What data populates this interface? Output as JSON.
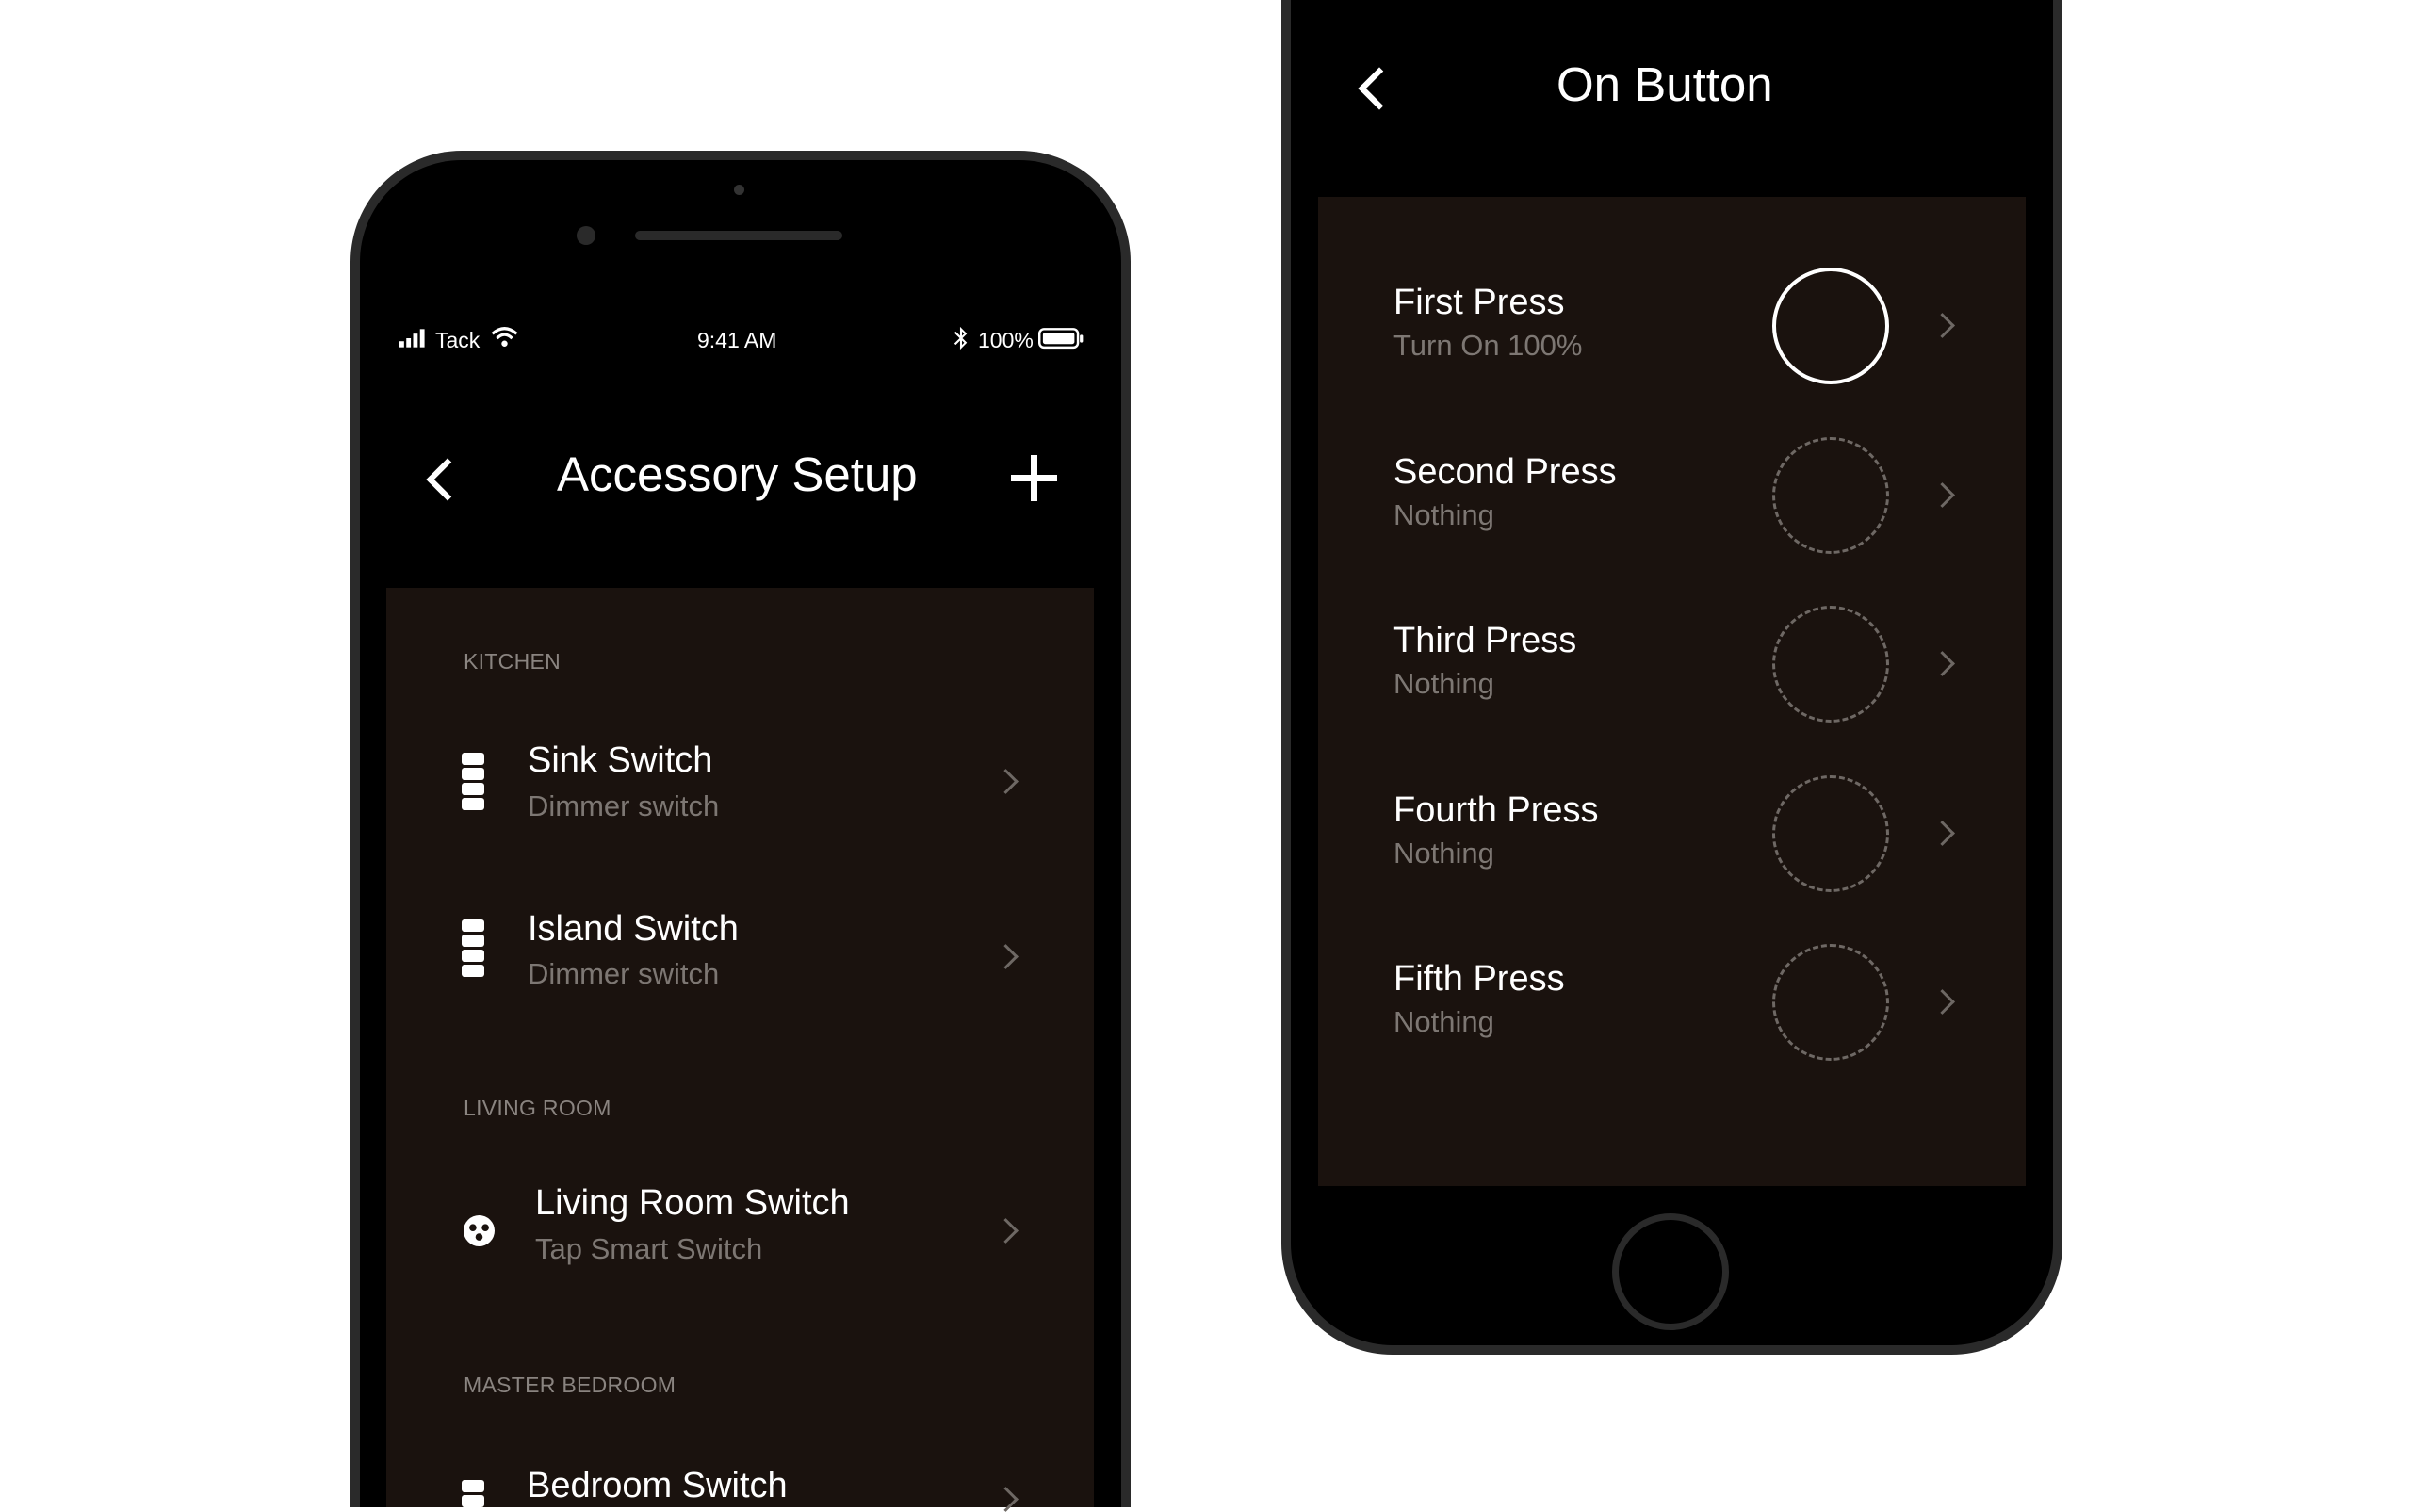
{
  "left_screen": {
    "status_bar": {
      "carrier": "Tack",
      "time": "9:41 AM",
      "battery": "100%",
      "battery_level": 1.0
    },
    "nav": {
      "title": "Accessory Setup",
      "back_icon": "chevron-left-icon",
      "add_icon": "plus-icon"
    },
    "sections": [
      {
        "label": "KITCHEN",
        "items": [
          {
            "title": "Sink Switch",
            "subtitle": "Dimmer switch",
            "icon": "dimmer-switch-icon"
          },
          {
            "title": "Island Switch",
            "subtitle": "Dimmer switch",
            "icon": "dimmer-switch-icon"
          }
        ]
      },
      {
        "label": "LIVING ROOM",
        "items": [
          {
            "title": "Living Room Switch",
            "subtitle": "Tap Smart Switch",
            "icon": "tap-switch-icon"
          }
        ]
      },
      {
        "label": "MASTER BEDROOM",
        "items": [
          {
            "title": "Bedroom Switch",
            "icon": "dimmer-switch-icon"
          }
        ]
      }
    ]
  },
  "right_screen": {
    "nav": {
      "title": "On Button",
      "back_icon": "chevron-left-icon"
    },
    "presses": [
      {
        "title": "First Press",
        "subtitle": "Turn On 100%",
        "assigned": true
      },
      {
        "title": "Second Press",
        "subtitle": "Nothing",
        "assigned": false
      },
      {
        "title": "Third Press",
        "subtitle": "Nothing",
        "assigned": false
      },
      {
        "title": "Fourth Press",
        "subtitle": "Nothing",
        "assigned": false
      },
      {
        "title": "Fifth Press",
        "subtitle": "Nothing",
        "assigned": false
      }
    ]
  },
  "colors": {
    "panel": "#1a120e",
    "screen": "#000000",
    "text_secondary": "#7d7773",
    "frame": "#2a2a2a"
  }
}
